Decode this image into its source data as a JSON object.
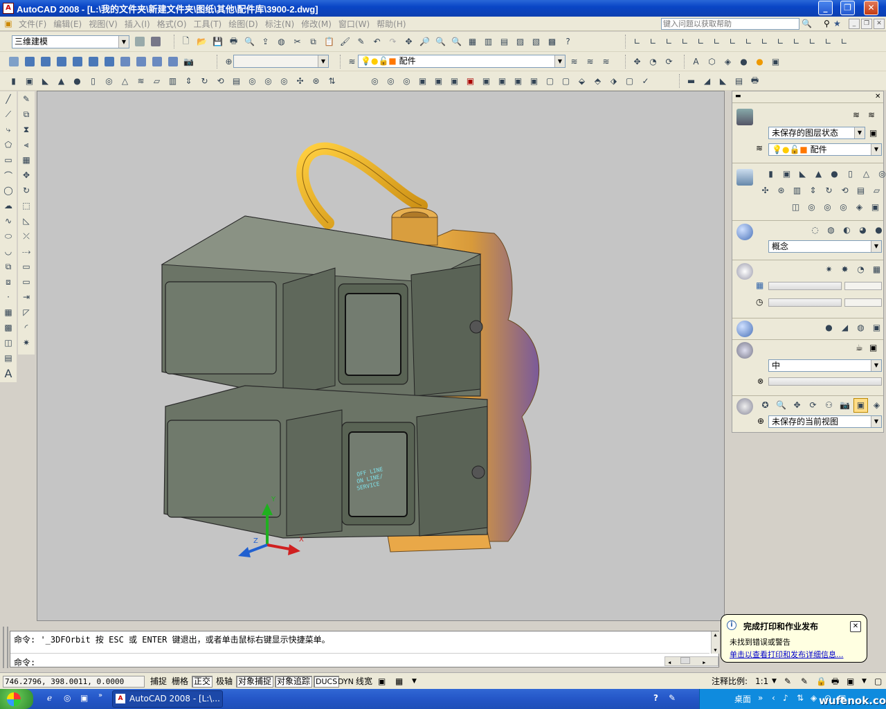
{
  "window": {
    "title": "AutoCAD 2008 - [L:\\我的文件夹\\新建文件夹\\图纸\\其他\\配件库\\3900-2.dwg]"
  },
  "menu": [
    "文件(F)",
    "编辑(E)",
    "视图(V)",
    "插入(I)",
    "格式(O)",
    "工具(T)",
    "绘图(D)",
    "标注(N)",
    "修改(M)",
    "窗口(W)",
    "帮助(H)"
  ],
  "help_search_placeholder": "键入问题以获取帮助",
  "toolbar": {
    "workspace": "三维建模",
    "layer": "配件"
  },
  "palette": {
    "layer_state": "未保存的图层状态",
    "layer": "配件",
    "visual_style": "概念",
    "material_quality": "中",
    "view": "未保存的当前视图"
  },
  "viewport": {
    "panel_text": [
      "OFF LINE",
      "ON LINE/",
      "SERVICE"
    ],
    "axes": {
      "x": "X",
      "y": "Y",
      "z": "Z"
    }
  },
  "command": {
    "history": "命令: '_3DFOrbit 按 ESC 或 ENTER 键退出，或者单击鼠标右键显示快捷菜单。",
    "prompt": "命令:"
  },
  "notification": {
    "title": "完成打印和作业发布",
    "message": "未找到错误或警告",
    "link": "单击以查看打印和发布详细信息..."
  },
  "status": {
    "coords": "746.2796,  398.0011,  0.0000",
    "buttons": [
      {
        "label": "捕捉",
        "on": false
      },
      {
        "label": "栅格",
        "on": false
      },
      {
        "label": "正交",
        "on": true
      },
      {
        "label": "极轴",
        "on": false
      },
      {
        "label": "对象捕捉",
        "on": true
      },
      {
        "label": "对象追踪",
        "on": true
      },
      {
        "label": "DUCS",
        "on": true
      },
      {
        "label": "DYN",
        "on": false
      },
      {
        "label": "线宽",
        "on": false
      }
    ],
    "scale_label": "注释比例:",
    "scale_value": "1:1"
  },
  "taskbar": {
    "task": "AutoCAD 2008 - [L:\\...",
    "desktop": "桌面",
    "watermark": "wufenok.com"
  },
  "colors": {
    "accent": "#0a46c6",
    "viewport": "#c5c5c5",
    "body_fill": "#6b7466",
    "pipe": "#e6a21e",
    "valve": "#c68a3a"
  }
}
